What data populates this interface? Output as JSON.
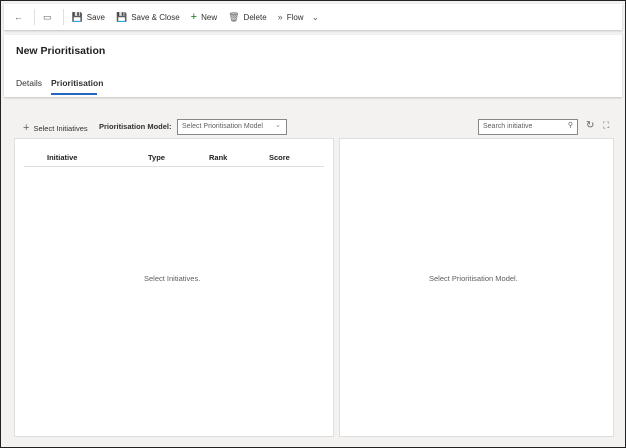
{
  "toolbar": {
    "save": "Save",
    "save_close": "Save & Close",
    "new": "New",
    "delete": "Delete",
    "flow": "Flow"
  },
  "header": {
    "title": "New Prioritisation",
    "tabs": [
      {
        "label": "Details"
      },
      {
        "label": "Prioritisation"
      }
    ],
    "active_tab": "Prioritisation"
  },
  "controls": {
    "select_initiatives": "Select Initiatives",
    "model_label": "Prioritisation Model:",
    "model_placeholder": "Select Prioritisation Model",
    "search_placeholder": "Search initiative"
  },
  "table": {
    "columns": [
      "Initiative",
      "Type",
      "Rank",
      "Score"
    ],
    "empty": "Select Initiatives."
  },
  "right_panel": {
    "empty": "Select Prioritisation Model."
  }
}
